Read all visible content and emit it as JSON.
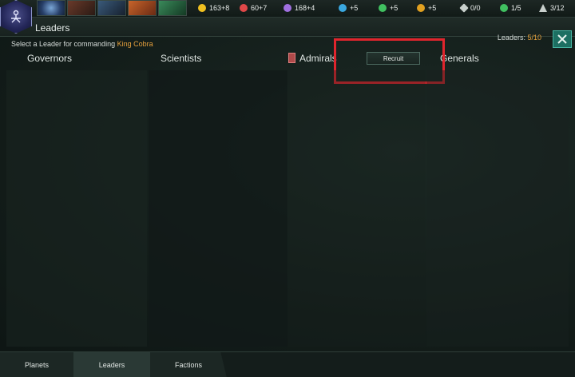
{
  "topbar": {
    "tabs": [
      {
        "name": "galaxy-map-tab"
      },
      {
        "name": "contacts-tab"
      },
      {
        "name": "ships-tab"
      },
      {
        "name": "situation-log-tab"
      },
      {
        "name": "technology-tab"
      }
    ],
    "resources": [
      {
        "name": "energy",
        "value": "163+8",
        "color": "#f0c020"
      },
      {
        "name": "minerals",
        "value": "60+7",
        "color": "#e04848"
      },
      {
        "name": "influence",
        "value": "168+4",
        "color": "#a070e0"
      },
      {
        "name": "physics-research",
        "value": "+5",
        "color": "#3aa8e0"
      },
      {
        "name": "society-research",
        "value": "+5",
        "color": "#40c060"
      },
      {
        "name": "engineering-research",
        "value": "+5",
        "color": "#e0a020"
      },
      {
        "name": "unity",
        "value": "0/0",
        "color": "#c8d0cc"
      },
      {
        "name": "planets",
        "value": "1/5",
        "color": "#40c060"
      },
      {
        "name": "fleet-capacity",
        "value": "3/12",
        "color": "#c8d0cc"
      }
    ]
  },
  "window": {
    "title": "Leaders",
    "subtitle_prefix": "Select a Leader for commanding",
    "subtitle_target": "King Cobra",
    "leaders_label": "Leaders:",
    "leaders_value": "5/10",
    "recruit_label": "Recruit",
    "columns": {
      "governors": "Governors",
      "scientists": "Scientists",
      "admirals": "Admirals",
      "generals": "Generals"
    }
  },
  "bottom_tabs": {
    "planets": "Planets",
    "leaders": "Leaders",
    "factions": "Factions"
  },
  "colors": {
    "accent": "#e8a13c",
    "highlight": "#e0252d",
    "close_button": "#1d6f62"
  }
}
